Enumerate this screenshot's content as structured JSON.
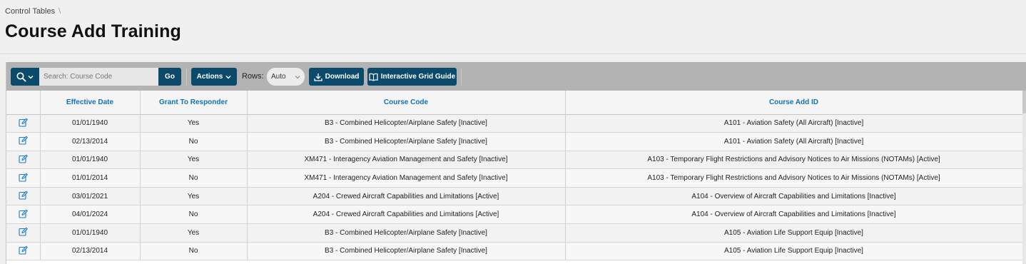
{
  "breadcrumb": {
    "item": "Control Tables",
    "separator": "\\"
  },
  "page": {
    "title": "Course Add Training"
  },
  "toolbar": {
    "search_placeholder": "Search: Course Code",
    "go_label": "Go",
    "actions_label": "Actions",
    "rows_label": "Rows:",
    "rows_value": "Auto",
    "download_label": "Download",
    "guide_label": "Interactive Grid Guide"
  },
  "grid": {
    "columns": [
      "",
      "Effective Date",
      "Grant To Responder",
      "Course Code",
      "Course Add ID"
    ],
    "rows": [
      {
        "date": "01/01/1940",
        "grant": "Yes",
        "code": "B3 - Combined Helicopter/Airplane Safety [Inactive]",
        "add_id": "A101 - Aviation Safety (All Aircraft) [Inactive]"
      },
      {
        "date": "02/13/2014",
        "grant": "No",
        "code": "B3 - Combined Helicopter/Airplane Safety [Inactive]",
        "add_id": "A101 - Aviation Safety (All Aircraft) [Inactive]"
      },
      {
        "date": "01/01/1940",
        "grant": "Yes",
        "code": "XM471 - Interagency Aviation Management and Safety [Inactive]",
        "add_id": "A103 - Temporary Flight Restrictions and Advisory Notices to Air Missions (NOTAMs) [Active]"
      },
      {
        "date": "01/01/2014",
        "grant": "No",
        "code": "XM471 - Interagency Aviation Management and Safety [Inactive]",
        "add_id": "A103 - Temporary Flight Restrictions and Advisory Notices to Air Missions (NOTAMs) [Active]"
      },
      {
        "date": "03/01/2021",
        "grant": "Yes",
        "code": "A204 - Crewed Aircraft Capabilities and Limitations [Active]",
        "add_id": "A104 - Overview of Aircraft Capabilities and Limitations [Inactive]"
      },
      {
        "date": "04/01/2024",
        "grant": "No",
        "code": "A204 - Crewed Aircraft Capabilities and Limitations [Active]",
        "add_id": "A104 - Overview of Aircraft Capabilities and Limitations [Inactive]"
      },
      {
        "date": "01/01/1940",
        "grant": "Yes",
        "code": "B3 - Combined Helicopter/Airplane Safety [Inactive]",
        "add_id": "A105 - Aviation Life Support Equip [Inactive]"
      },
      {
        "date": "02/13/2014",
        "grant": "No",
        "code": "B3 - Combined Helicopter/Airplane Safety [Inactive]",
        "add_id": "A105 - Aviation Life Support Equip [Inactive]"
      }
    ]
  },
  "colors": {
    "accent": "#0b4a6b",
    "header_text": "#0e72b9",
    "toolbar_bg": "#b3b3b3",
    "edit_icon": "#1b7bc4"
  },
  "icons": {
    "search": "search-icon",
    "edit": "edit-icon",
    "download": "download-icon",
    "guide": "book-icon"
  }
}
